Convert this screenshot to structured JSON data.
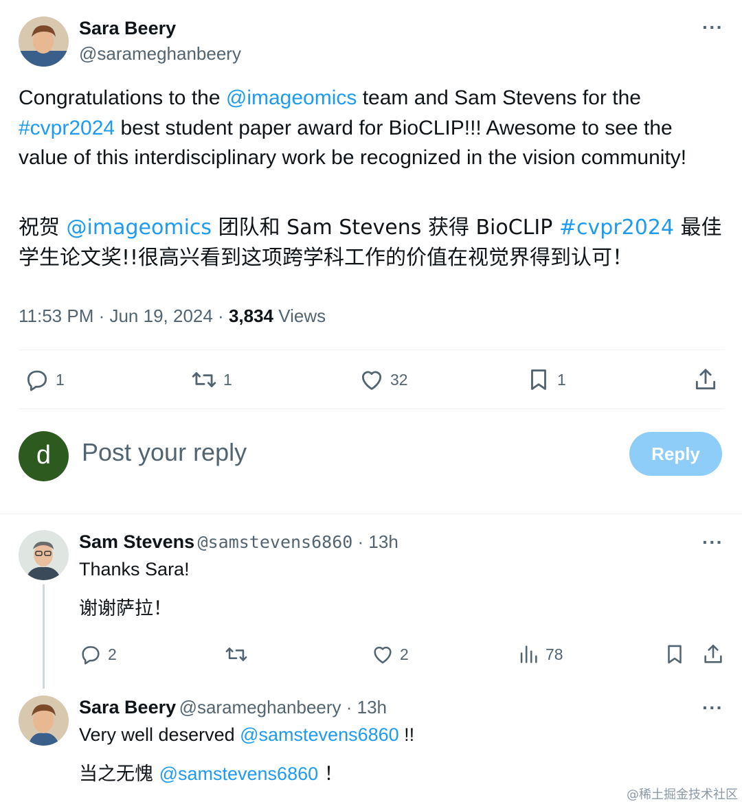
{
  "main_tweet": {
    "author_name": "Sara Beery",
    "author_handle": "@sarameghanbeery",
    "more_label": "···",
    "en": {
      "p1": "Congratulations to the ",
      "mention": "@imageomics",
      "p2": " team and Sam Stevens for the ",
      "hashtag": "#cvpr2024",
      "p3": " best student paper award for BioCLIP!!! Awesome to see the value of this interdisciplinary work be recognized in the vision community!"
    },
    "zh": {
      "p1": "祝贺 ",
      "mention": "@imageomics",
      "p2": " 团队和 Sam Stevens 获得 BioCLIP ",
      "hashtag": "#cvpr2024",
      "p3": " 最佳学生论文奖!!很高兴看到这项跨学科工作的价值在视觉界得到认可！"
    },
    "time": "11:53 PM",
    "dot": " · ",
    "date": "Jun 19, 2024",
    "views_count": "3,834",
    "views_label": " Views",
    "actions": {
      "reply_count": "1",
      "repost_count": "1",
      "like_count": "32",
      "bookmark_count": "1"
    }
  },
  "compose": {
    "avatar_letter": "d",
    "avatar_color": "#2d5a1f",
    "placeholder": "Post your reply",
    "reply_button": "Reply"
  },
  "replies": [
    {
      "author_name": "Sam Stevens",
      "author_handle": "@samstevens6860",
      "age": " · 13h",
      "line1": "Thanks Sara!",
      "line2": "谢谢萨拉！",
      "reply_count": "2",
      "like_count": "2",
      "views_count": "78"
    },
    {
      "author_name": "Sara Beery",
      "author_handle": "@sarameghanbeery",
      "age": " · 13h",
      "line1_text": "Very well deserved ",
      "line1_mention": "@samstevens6860",
      "line1_end": " !!",
      "line2_text": "当之无愧 ",
      "line2_mention": "@samstevens6860",
      "line2_end": " ！"
    }
  ],
  "watermark": "@稀土掘金技术社区",
  "colors": {
    "accent": "#1d9bf0",
    "muted": "#536471",
    "reply_button": "#8ecdf8"
  }
}
